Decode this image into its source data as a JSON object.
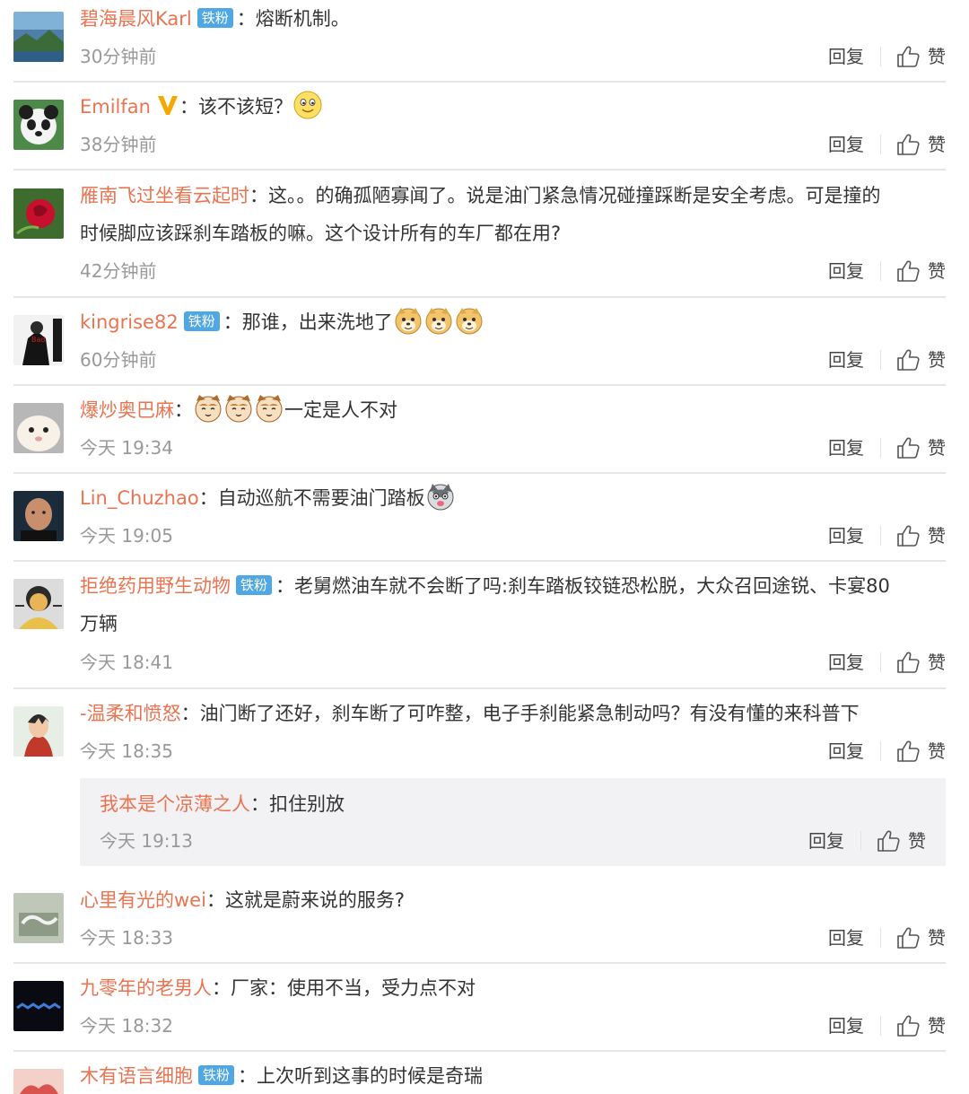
{
  "labels": {
    "reply": "回复",
    "like": "赞",
    "colon": "："
  },
  "comments": [
    {
      "user": "碧海晨风Karl",
      "badge": "铁粉",
      "text": "熔断机制。",
      "time": "30分钟前"
    },
    {
      "user": "Emilfan",
      "text": "该不该短？",
      "time": "38分钟前"
    },
    {
      "user": "雁南飞过坐看云起时",
      "text1": "这。。的确孤陋寡闻了。说是油门紧急情况碰撞踩断是安全考虑。可是撞的",
      "text2": "时候脚应该踩刹车踏板的嘛。这个设计所有的车厂都在用?",
      "time": "42分钟前"
    },
    {
      "user": "kingrise82",
      "badge": "铁粉",
      "text": "那谁，出来洗地了",
      "time": "60分钟前"
    },
    {
      "user": "爆炒奥巴麻",
      "text": "一定是人不对",
      "time": "今天 19:34"
    },
    {
      "user": "Lin_Chuzhao",
      "text": "自动巡航不需要油门踏板",
      "time": "今天 19:05"
    },
    {
      "user": "拒绝药用野生动物",
      "badge": "铁粉",
      "text1": "老舅燃油车就不会断了吗:刹车踏板铰链恐松脱，大众召回途锐、卡宴80",
      "text2": "万辆",
      "time": "今天 18:41"
    },
    {
      "user": "-温柔和愤怒",
      "text": "油门断了还好，刹车断了可咋整，电子手刹能紧急制动吗？有没有懂的来科普下",
      "time": "今天 18:35"
    },
    {
      "user": "心里有光的wei",
      "text": "这就是蔚来说的服务?",
      "time": "今天 18:33"
    },
    {
      "user": "九零年的老男人",
      "text": "厂家：使用不当，受力点不对",
      "time": "今天 18:32"
    },
    {
      "user": "木有语言细胞",
      "badge": "铁粉",
      "text": "上次听到这事的时候是奇瑞"
    }
  ],
  "subreply": {
    "user": "我本是个凉薄之人",
    "text": "扣住别放",
    "time": "今天 19:13"
  },
  "colors": {
    "username": "#eb7350",
    "badge": "#4fa7e4",
    "timestamp": "#999999",
    "subreply_bg": "#f2f2f5"
  }
}
